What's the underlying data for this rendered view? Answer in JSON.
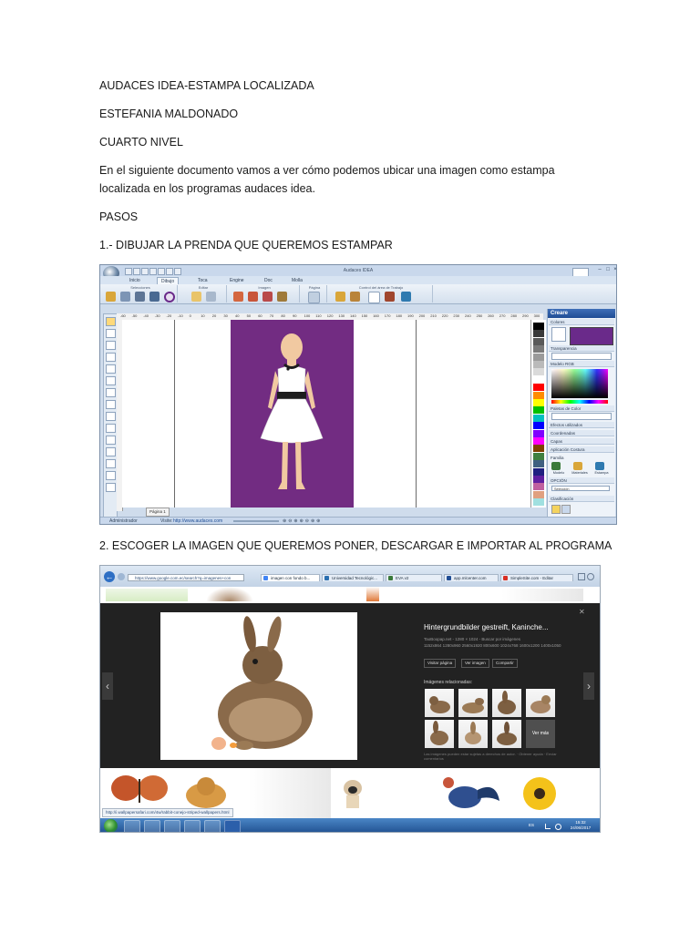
{
  "document": {
    "title": "AUDACES IDEA-ESTAMPA LOCALIZADA",
    "author": "ESTEFANIA MALDONADO",
    "level": "CUARTO NIVEL",
    "intro": "En el siguiente documento vamos a ver cómo podemos ubicar una imagen como estampa localizada en los programas audaces idea.",
    "steps_heading": "PASOS",
    "step1": "1.- DIBUJAR LA PRENDA QUE QUEREMOS ESTAMPAR",
    "step2": "2. ESCOGER LA IMAGEN QUE QUEREMOS PONER, DESCARGAR E IMPORTAR AL PROGRAMA"
  },
  "screenshot1": {
    "window_title": "Audaces IDEA",
    "tabs": [
      "Inicio",
      "Dibujo",
      "Toca",
      "Engine",
      "Doc",
      "Molla"
    ],
    "ribbon_groups": [
      "Selecciones",
      "Editar",
      "Imagen",
      "Página",
      "Control del área de Trabajo"
    ],
    "ruler_ticks": [
      "-60",
      "-50",
      "-40",
      "-30",
      "-20",
      "-10",
      "0",
      "10",
      "20",
      "30",
      "40",
      "50",
      "60",
      "70",
      "80",
      "90",
      "100",
      "110",
      "120",
      "130",
      "140",
      "150",
      "160",
      "170",
      "180",
      "190",
      "200",
      "210",
      "220",
      "230",
      "240",
      "250",
      "260",
      "270",
      "280",
      "290",
      "300"
    ],
    "page_tab": "Página 1",
    "status_user": "Administrador",
    "status_site_label": "Visite:",
    "status_site": "http://www.audaces.com",
    "panel": {
      "title": "Creare",
      "rows": [
        "Colores",
        "Transparencia",
        "Modelo RGB",
        "Paletas de Color",
        "Efectos utilizados",
        "Coordenadas",
        "Capas",
        "Aplicación Costura",
        "Familia",
        "OPCIÓN",
        "Clasificación"
      ],
      "family_items": [
        "Modelo",
        "Materiales",
        "Estampa"
      ],
      "select_value": "Selección"
    },
    "palette_colors": [
      "#000000",
      "#3a3a3a",
      "#5a5a5a",
      "#7a7a7a",
      "#9a9a9a",
      "#bababa",
      "#dadada",
      "#ffffff",
      "#ff0000",
      "#ff8c00",
      "#ffff00",
      "#00c000",
      "#00c0c0",
      "#0000ff",
      "#8000ff",
      "#ff00ff",
      "#804000",
      "#408040",
      "#406080",
      "#202080",
      "#6020a0",
      "#c060a0",
      "#e0a080",
      "#a0e0e0"
    ],
    "colors": {
      "canvas_purple": "#722c82",
      "selected_purple": "#6a2a8a"
    }
  },
  "screenshot2": {
    "address": "https://www.google.com.ec/search?q=imagenes+con",
    "tabs": [
      "imagen con fondo b...",
      "Universidad Tecnológic...",
      "EVA v2",
      "app.mlcenter.com",
      "SimpleSite.com - Editar"
    ],
    "tab_colors": [
      "#4285f4",
      "#2a6fb0",
      "#3a7a3a",
      "#1f4d95",
      "#d93025"
    ],
    "image_title": "Hintergrundbilder gestreift, Kaninche...",
    "image_source": "TaoBoopap.net - 1280 × 1024 - Buscar por imágenes",
    "image_sizes": "1152x864 1280x960 2560x1920 800x600 1024x768 1600x1200 1400x1050",
    "buttons": [
      "Visitar página",
      "Ver imagen",
      "Compartir"
    ],
    "related_label": "Imágenes relacionadas:",
    "more_label": "Ver más",
    "disclaimer": "Las imágenes pueden estar sujetas a derechos de autor. · Obtener ayuda · Enviar comentarios",
    "status_url": "http://i.wallpapersafari.com/4w/rabbit-conejo-striped-wallpapers.html",
    "tray": {
      "lang": "ES",
      "time": "15:32",
      "date": "24/06/2017"
    }
  }
}
